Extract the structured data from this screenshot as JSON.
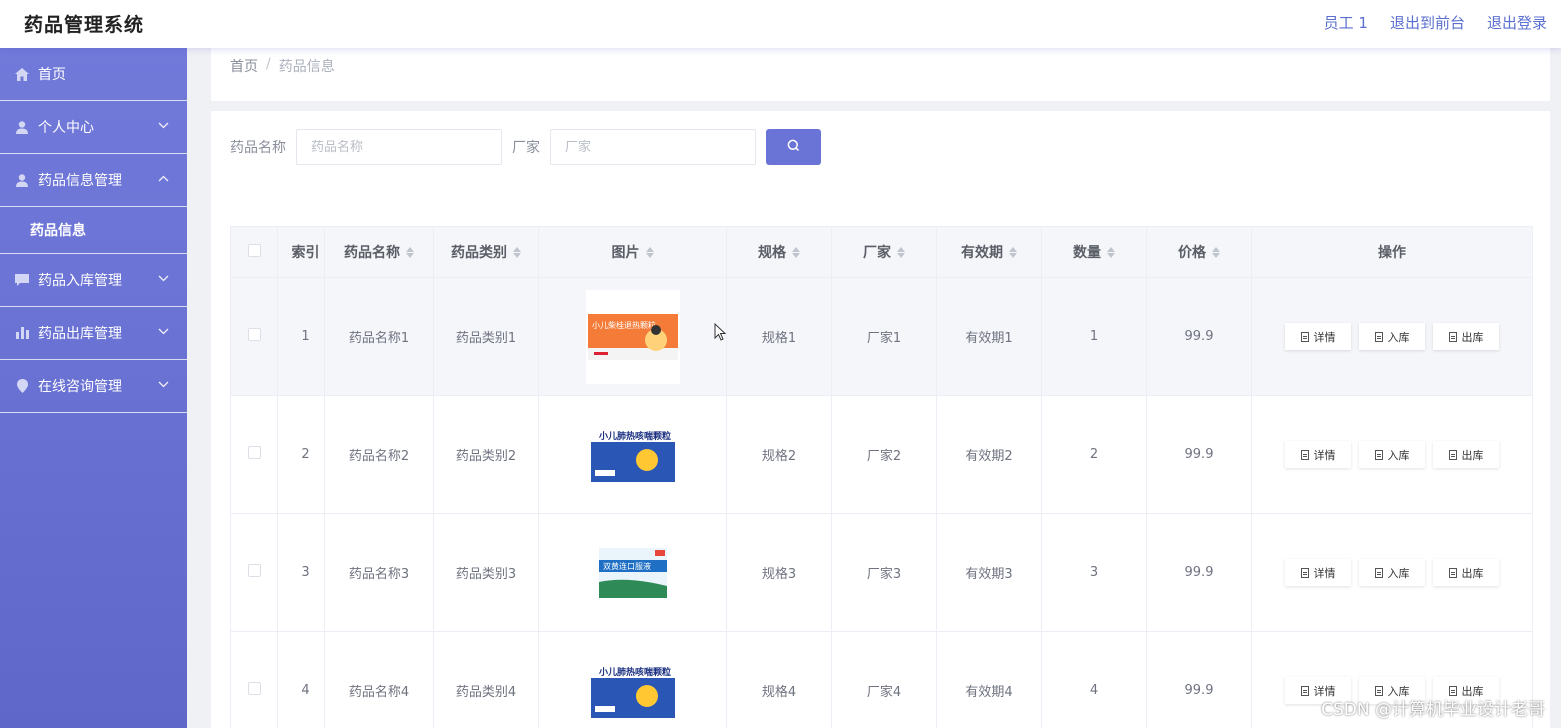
{
  "app": {
    "title": "药品管理系统"
  },
  "header": {
    "user": "员工 1",
    "to_front": "退出到前台",
    "logout": "退出登录"
  },
  "sidebar": {
    "items": [
      {
        "label": "首页",
        "icon": "home-icon"
      },
      {
        "label": "个人中心",
        "icon": "user-icon",
        "expanded": false
      },
      {
        "label": "药品信息管理",
        "icon": "user-icon",
        "expanded": true,
        "children": [
          {
            "label": "药品信息"
          }
        ]
      },
      {
        "label": "药品入库管理",
        "icon": "chat-icon",
        "expanded": false
      },
      {
        "label": "药品出库管理",
        "icon": "bar-chart-icon",
        "expanded": false
      },
      {
        "label": "在线咨询管理",
        "icon": "location-pin-icon",
        "expanded": false
      }
    ]
  },
  "breadcrumb": {
    "home": "首页",
    "sep": "/",
    "current": "药品信息"
  },
  "search": {
    "name_label": "药品名称",
    "name_placeholder": "药品名称",
    "name_value": "",
    "maker_label": "厂家",
    "maker_placeholder": "厂家",
    "maker_value": ""
  },
  "table": {
    "columns": [
      "索引",
      "药品名称",
      "药品类别",
      "图片",
      "规格",
      "厂家",
      "有效期",
      "数量",
      "价格",
      "操作"
    ],
    "actions": {
      "detail": "详情",
      "in": "入库",
      "out": "出库"
    },
    "rows": [
      {
        "idx": "1",
        "name": "药品名称1",
        "cat": "药品类别1",
        "spec": "规格1",
        "maker": "厂家1",
        "exp": "有效期1",
        "qty": "1",
        "price": "99.9",
        "box_text": "小儿柴桂退热颗粒"
      },
      {
        "idx": "2",
        "name": "药品名称2",
        "cat": "药品类别2",
        "spec": "规格2",
        "maker": "厂家2",
        "exp": "有效期2",
        "qty": "2",
        "price": "99.9",
        "box_text": "小儿肺热咳喘颗粒"
      },
      {
        "idx": "3",
        "name": "药品名称3",
        "cat": "药品类别3",
        "spec": "规格3",
        "maker": "厂家3",
        "exp": "有效期3",
        "qty": "3",
        "price": "99.9",
        "box_text": "双黄连口服液"
      },
      {
        "idx": "4",
        "name": "药品名称4",
        "cat": "药品类别4",
        "spec": "规格4",
        "maker": "厂家4",
        "exp": "有效期4",
        "qty": "4",
        "price": "99.9",
        "box_text": "小儿肺热咳喘颗粒"
      }
    ]
  },
  "watermark": "CSDN @计算机毕业设计老哥",
  "colors": {
    "accent": "#6a73d6",
    "sidebar_top": "#7179d9",
    "sidebar_bottom": "#5f67c8"
  }
}
